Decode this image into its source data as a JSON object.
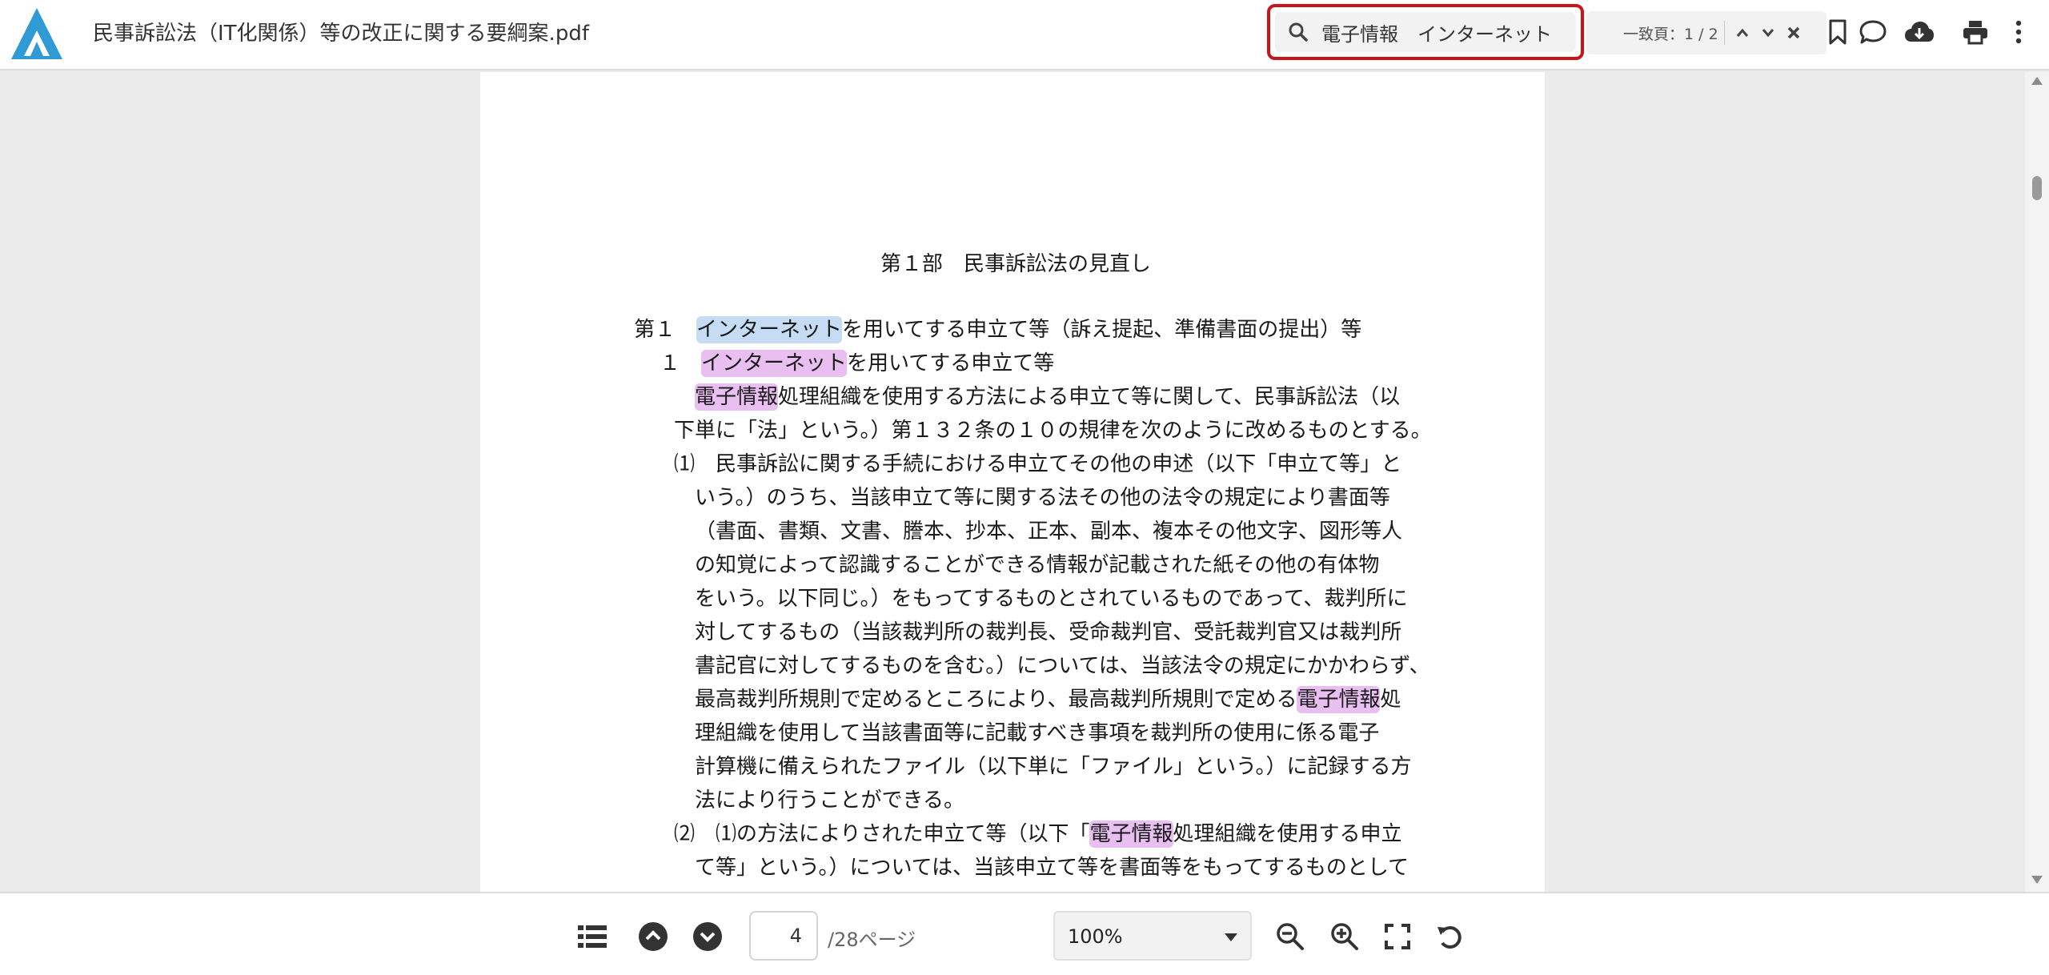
{
  "app": {
    "document_title": "民事訴訟法（IT化関係）等の改正に関する要綱案.pdf"
  },
  "search": {
    "query": "電子情報　インターネット",
    "hit_count_label": "一致頁：1 / 2"
  },
  "colors": {
    "search_box_outline": "#c9141c",
    "logo_blue": "#2f9ad6",
    "highlight_current": "#c6dcf5",
    "highlight_other": "#e8bff0"
  },
  "icons": {
    "search": "search-icon",
    "prev_hit": "chevron-up-icon",
    "next_hit": "chevron-down-icon",
    "close": "close-icon",
    "bookmark": "bookmark-icon",
    "comment": "comment-icon",
    "download": "cloud-download-icon",
    "print": "print-icon",
    "more": "more-vertical-icon",
    "toc": "list-icon",
    "page_up": "circle-chevron-up-icon",
    "page_down": "circle-chevron-down-icon",
    "zoom_out": "zoom-out-icon",
    "zoom_in": "zoom-in-icon",
    "fit": "fullscreen-icon",
    "rotate": "rotate-icon"
  },
  "document": {
    "heading": "第１部　民事訴訟法の見直し",
    "lines": [
      [
        {
          "t": "第１　"
        },
        {
          "t": "インターネット",
          "hl": "cur"
        },
        {
          "t": "を用いてする申立て等（訴え提起、準備書面の提出）等"
        }
      ],
      [
        {
          "t": "１　"
        },
        {
          "t": "インターネット",
          "hl": "pk"
        },
        {
          "t": "を用いてする申立て等"
        }
      ],
      [
        {
          "t": "電子情報",
          "hl": "pk"
        },
        {
          "t": "処理組織を使用する方法による申立て等に関して、民事訴訟法（以"
        }
      ],
      [
        {
          "t": "下単に「法」という。）第１３２条の１０の規律を次のように改めるものとする。"
        }
      ],
      [
        {
          "t": "⑴　民事訴訟に関する手続における申立てその他の申述（以下「申立て等」と"
        }
      ],
      [
        {
          "t": "いう。）のうち、当該申立て等に関する法その他の法令の規定により書面等"
        }
      ],
      [
        {
          "t": "（書面、書類、文書、謄本、抄本、正本、副本、複本その他文字、図形等人"
        }
      ],
      [
        {
          "t": "の知覚によって認識することができる情報が記載された紙その他の有体物"
        }
      ],
      [
        {
          "t": "をいう。以下同じ。）をもってするものとされているものであって、裁判所に"
        }
      ],
      [
        {
          "t": "対してするもの（当該裁判所の裁判長、受命裁判官、受託裁判官又は裁判所"
        }
      ],
      [
        {
          "t": "書記官に対してするものを含む。）については、当該法令の規定にかかわらず、"
        }
      ],
      [
        {
          "t": "最高裁判所規則で定めるところにより、最高裁判所規則で定める"
        },
        {
          "t": "電子情報",
          "hl": "pk"
        },
        {
          "t": "処"
        }
      ],
      [
        {
          "t": "理組織を使用して当該書面等に記載すべき事項を裁判所の使用に係る電子"
        }
      ],
      [
        {
          "t": "計算機に備えられたファイル（以下単に「ファイル」という。）に記録する方"
        }
      ],
      [
        {
          "t": "法により行うことができる。"
        }
      ],
      [
        {
          "t": "⑵　⑴の方法によりされた申立て等（以下「"
        },
        {
          "t": "電子情報",
          "hl": "pk"
        },
        {
          "t": "処理組織を使用する申立"
        }
      ],
      [
        {
          "t": "て等」という。）については、当該申立て等を書面等をもってするものとして"
        }
      ]
    ]
  },
  "footer": {
    "current_page": "4",
    "page_total_label": "/28ページ",
    "zoom_value": "100%"
  }
}
